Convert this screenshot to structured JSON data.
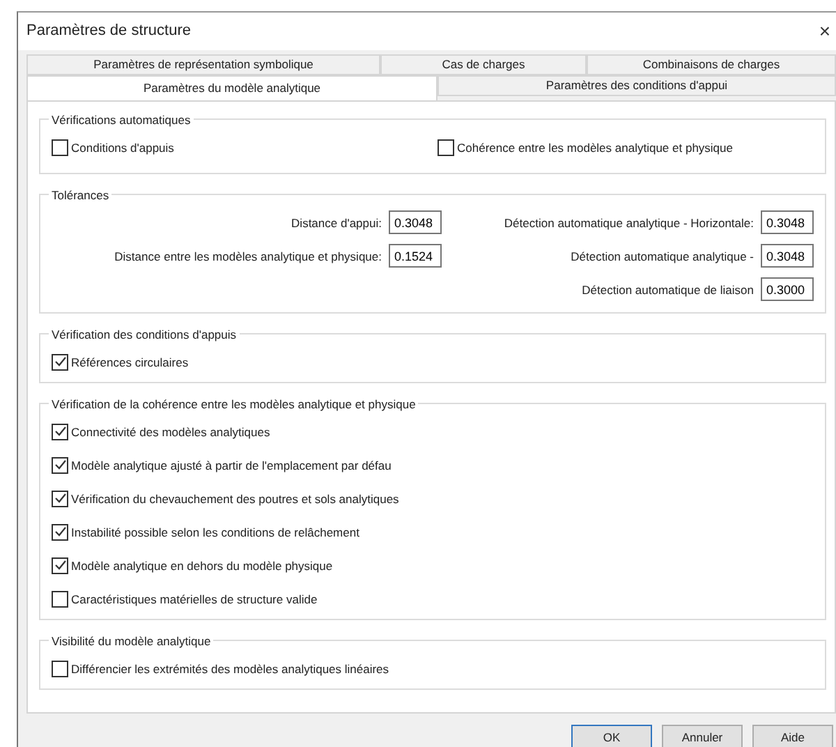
{
  "window": {
    "title": "Paramètres de structure",
    "close": "×"
  },
  "tabs": [
    [
      {
        "label": "Paramètres de représentation symbolique",
        "selected": false
      },
      {
        "label": "Cas de charges",
        "selected": false
      },
      {
        "label": "Combinaisons de charges",
        "selected": false
      }
    ],
    [
      {
        "label": "Paramètres du modèle analytique",
        "selected": true
      },
      {
        "label": "Paramètres des conditions d'appui",
        "selected": false
      }
    ]
  ],
  "auto_checks": {
    "title": "Vérifications automatiques",
    "items": [
      {
        "label": "Conditions d'appuis",
        "checked": false
      },
      {
        "label": "Cohérence entre les modèles analytique et physique",
        "checked": false
      }
    ]
  },
  "tolerances": {
    "title": "Tolérances",
    "left_fields": [
      {
        "label": "Distance d'appui:",
        "value": "0.3048"
      },
      {
        "label": "Distance entre les modèles analytique et physique:",
        "value": "0.1524"
      }
    ],
    "right_fields": [
      {
        "label": "Détection automatique analytique - Horizontale:",
        "value": "0.3048"
      },
      {
        "label": "Détection automatique analytique -",
        "value": "0.3048"
      },
      {
        "label": "Détection automatique de liaison",
        "value": "0.3000"
      }
    ]
  },
  "support_checks": {
    "title": "Vérification des conditions d'appuis",
    "items": [
      {
        "label": "Références circulaires",
        "checked": true
      }
    ]
  },
  "coherence_checks": {
    "title": "Vérification de la cohérence entre les modèles analytique et physique",
    "items": [
      {
        "label": "Connectivité des modèles analytiques",
        "checked": true
      },
      {
        "label": "Modèle analytique ajusté à partir de l'emplacement par défau",
        "checked": true
      },
      {
        "label": "Vérification du chevauchement des poutres et sols analytiques",
        "checked": true
      },
      {
        "label": "Instabilité possible selon les conditions de relâchement",
        "checked": true
      },
      {
        "label": "Modèle analytique en dehors du modèle physique",
        "checked": true
      },
      {
        "label": "Caractéristiques matérielles de structure valide",
        "checked": false
      }
    ]
  },
  "visibility": {
    "title": "Visibilité du modèle analytique",
    "items": [
      {
        "label": "Différencier les extrémités des modèles analytiques linéaires",
        "checked": false
      }
    ]
  },
  "buttons": [
    {
      "label": "OK",
      "default": true
    },
    {
      "label": "Annuler",
      "default": false
    },
    {
      "label": "Aide",
      "default": false
    }
  ]
}
